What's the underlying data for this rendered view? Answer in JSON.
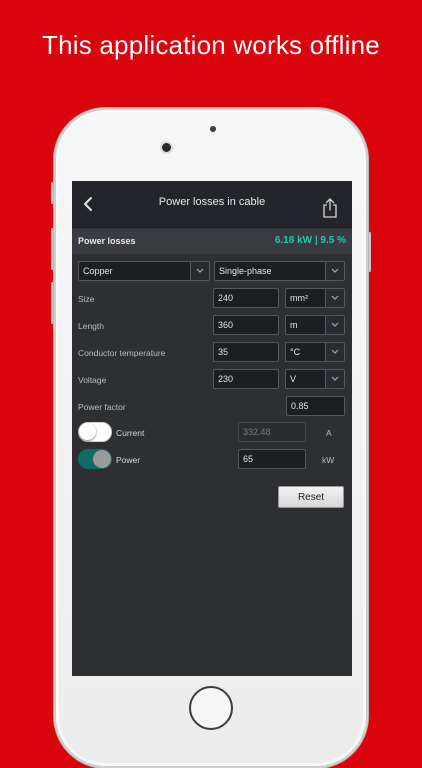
{
  "headline": "This application works offline",
  "navbar": {
    "title": "Power losses in cable"
  },
  "summary": {
    "title": "Power losses",
    "result": "6.18 kW | 9.5 %"
  },
  "material": {
    "value": "Copper"
  },
  "phase": {
    "value": "Single-phase"
  },
  "size": {
    "label": "Size",
    "value": "240",
    "unit": "mm²"
  },
  "length": {
    "label": "Length",
    "value": "360",
    "unit": "m"
  },
  "temperature": {
    "label": "Conductor temperature",
    "value": "35",
    "unit": "°C"
  },
  "voltage": {
    "label": "Voltage",
    "value": "230",
    "unit": "V"
  },
  "power_factor": {
    "label": "Power factor",
    "value": "0.85"
  },
  "current": {
    "label": "Current",
    "value": "332.48",
    "unit": "A",
    "enabled": false
  },
  "power": {
    "label": "Power",
    "value": "65",
    "unit": "kW",
    "enabled": true
  },
  "reset_label": "Reset",
  "colors": {
    "background": "#d9040c",
    "accent": "#21c4b5",
    "toggle_on": "#0d6d62"
  },
  "icons": {
    "back": "chevron-left-icon",
    "share": "share-icon",
    "dropdown": "chevron-down-icon"
  }
}
